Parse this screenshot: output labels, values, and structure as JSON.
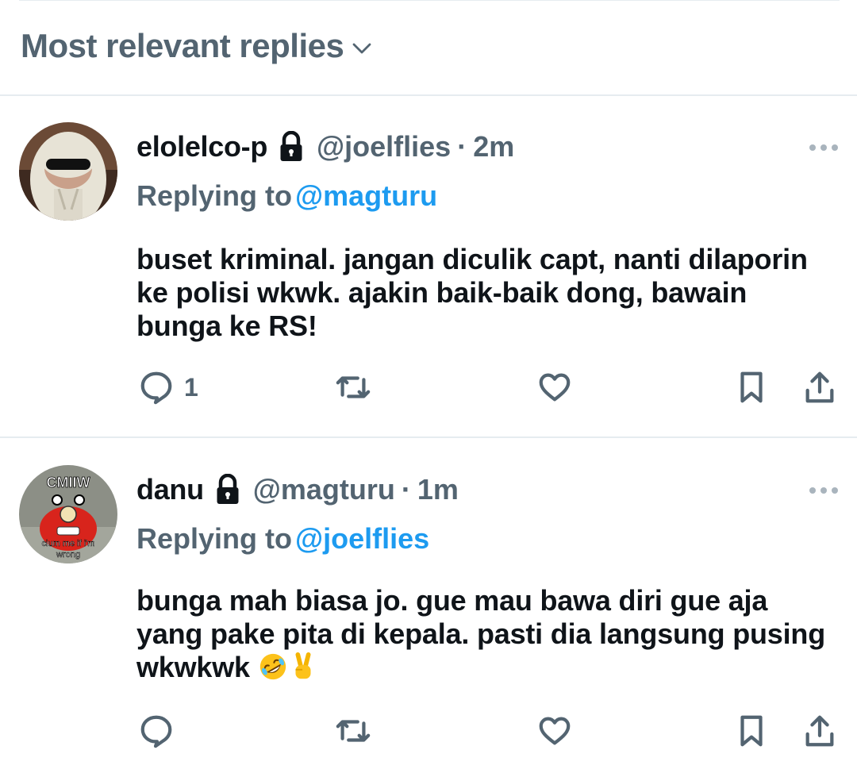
{
  "header": {
    "sort_label": "Most relevant replies"
  },
  "tweets": [
    {
      "name": "elolelco-p",
      "handle": "@joelflies",
      "separator": "·",
      "time": "2m",
      "replying_prefix": "Replying to",
      "replying_to": "@magturu",
      "body": "buset kriminal. jangan diculik capt, nanti dilaporin ke polisi wkwk. ajakin baik-baik dong, bawain bunga ke RS!",
      "reply_count": "1"
    },
    {
      "name": "danu",
      "handle": "@magturu",
      "separator": "·",
      "time": "1m",
      "replying_prefix": "Replying to",
      "replying_to": "@joelflies",
      "body": "bunga mah biasa jo. gue mau bawa diri gue aja yang pake pita di kepala. pasti dia langsung pusing wkwkwk",
      "avatar_text_top": "CMIIW",
      "avatar_text_bottom": "ciumme if i'm wrong",
      "emojis": [
        "rolling-on-floor-laughing",
        "victory-hand"
      ]
    }
  ],
  "colors": {
    "text": "#0f1419",
    "secondary": "#536471",
    "accent": "#1d9bf0",
    "divider": "#e6ecf0"
  }
}
